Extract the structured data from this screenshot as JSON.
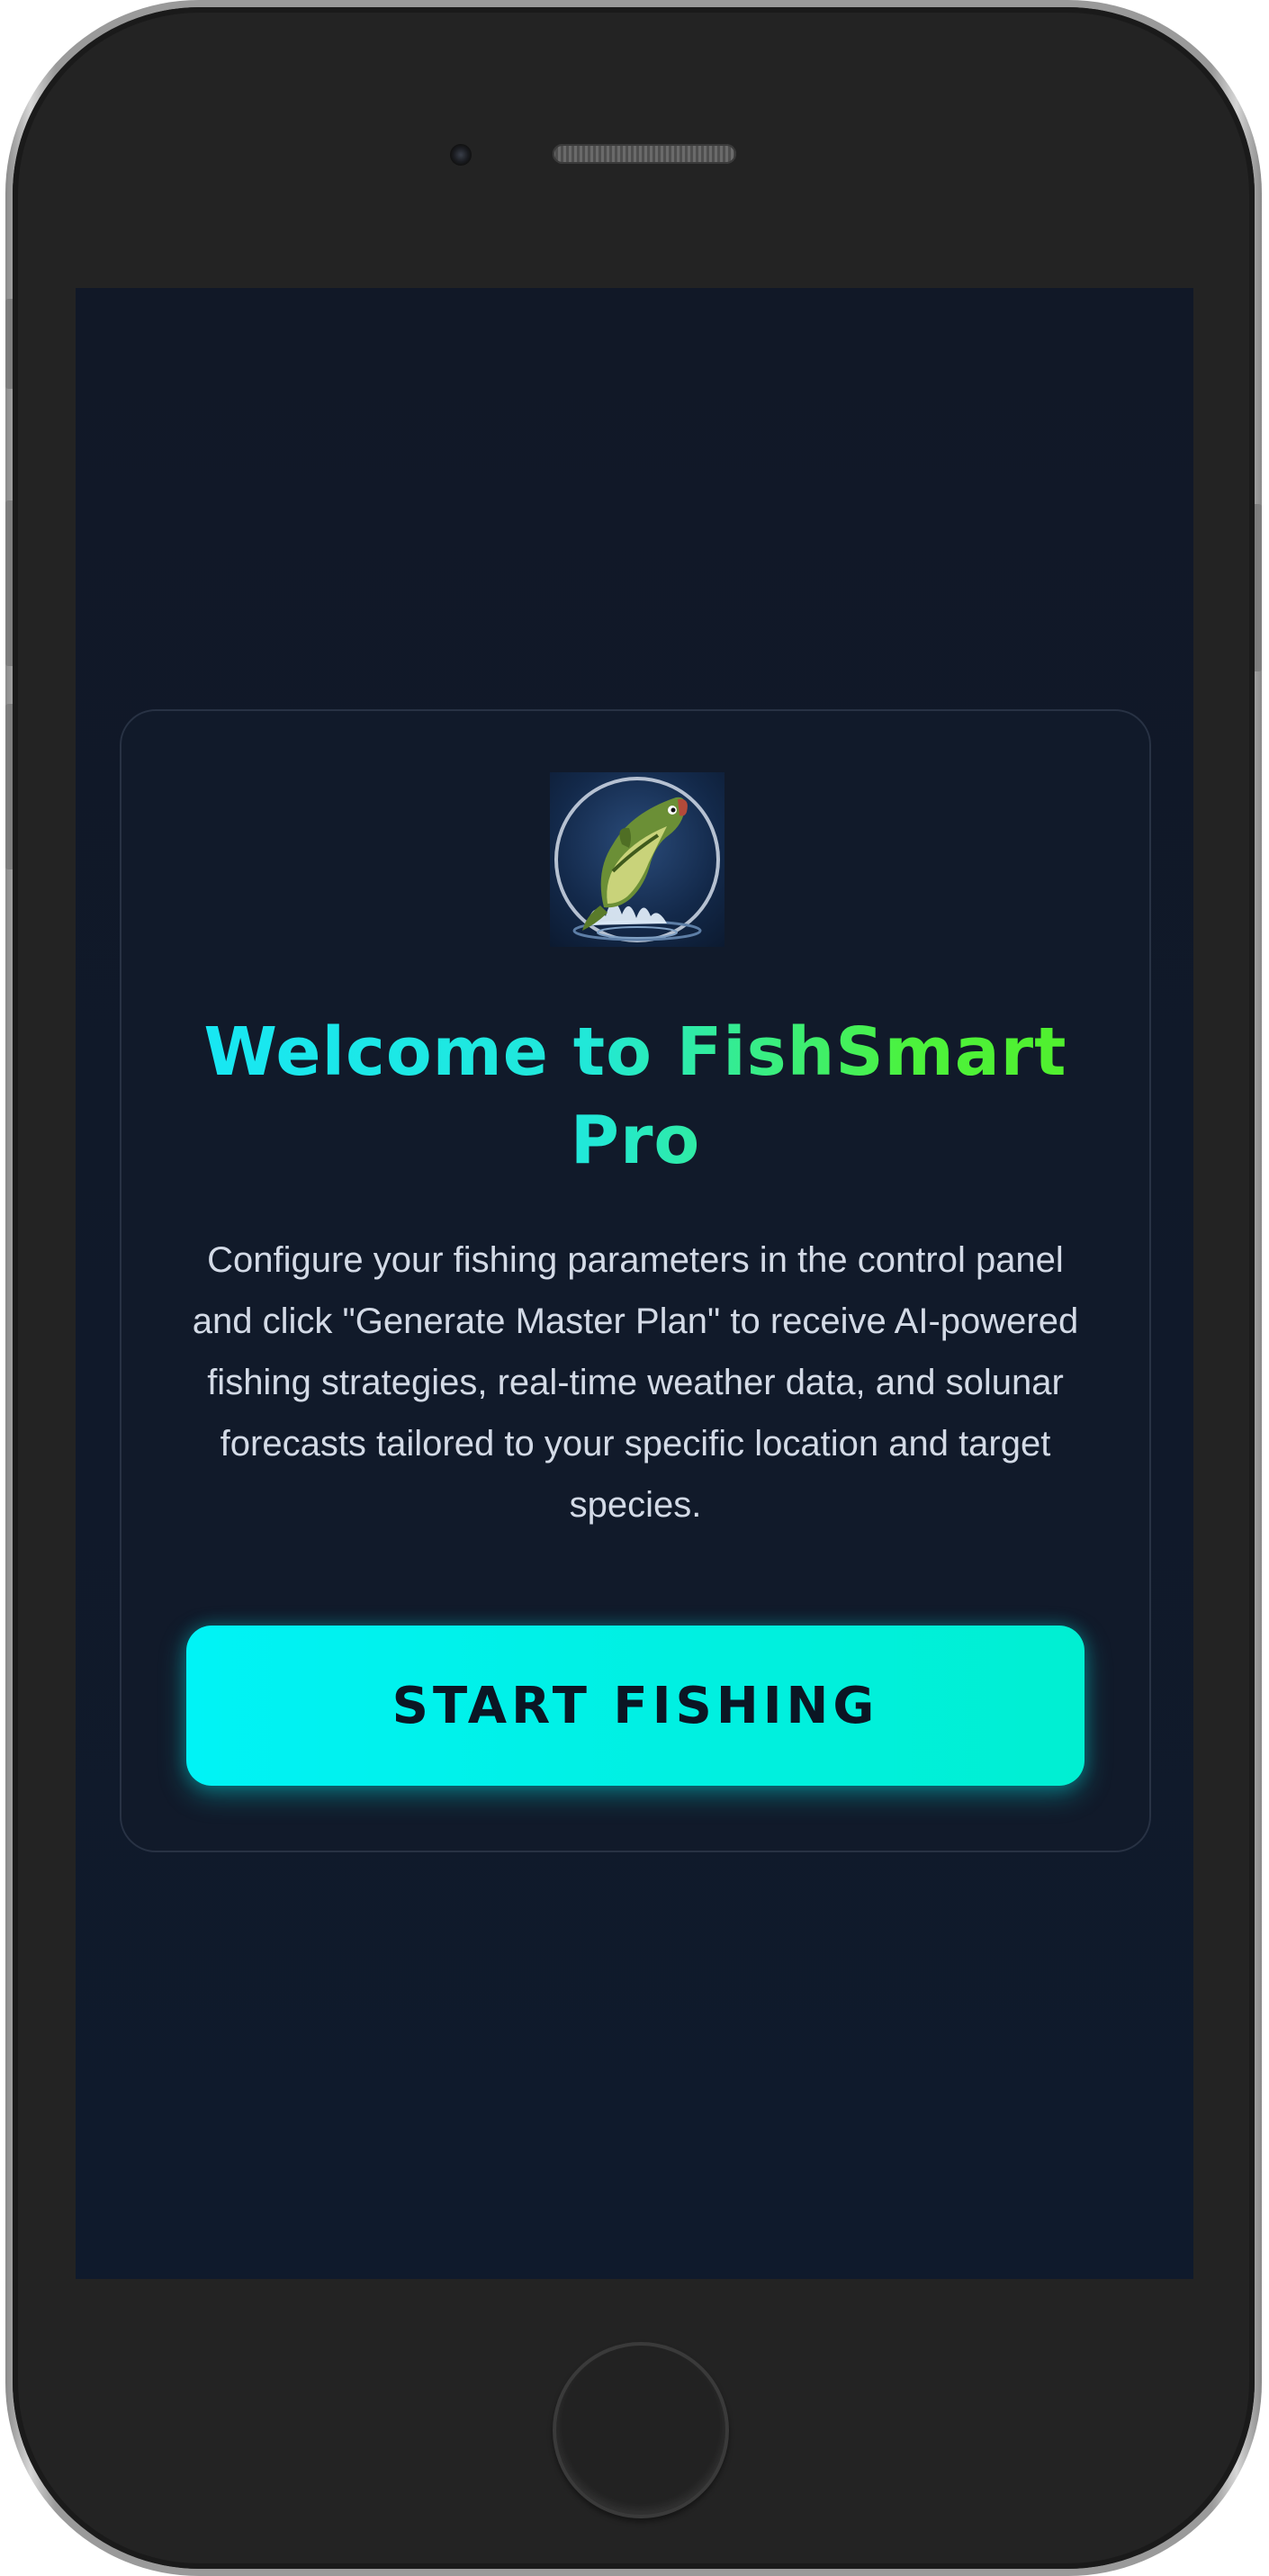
{
  "app": {
    "title": "Welcome to FishSmart Pro",
    "description": "Configure your fishing parameters in the control panel and click \"Generate Master Plan\" to receive AI-powered fishing strategies, real-time weather data, and solunar forecasts tailored to your specific location and target species.",
    "start_button_label": "START FISHING",
    "logo_icon": "jumping-bass-icon"
  },
  "colors": {
    "background": "#111827",
    "title_gradient_start": "#17e7f5",
    "title_gradient_end": "#52f02c",
    "button_gradient_start": "#00f3f6",
    "button_gradient_end": "#00efd2",
    "button_text": "#0b1624",
    "description_text": "#d3dae6"
  }
}
